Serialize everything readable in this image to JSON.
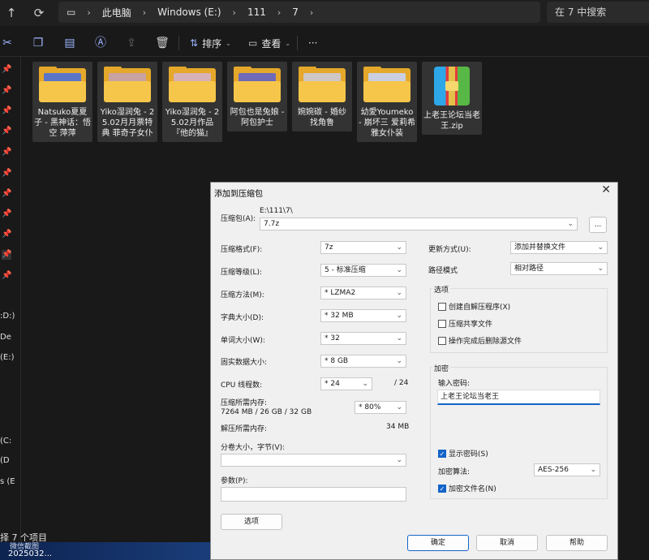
{
  "topbar": {
    "path": [
      "此电脑",
      "Windows (E:)",
      "111",
      "7"
    ],
    "search_placeholder": "在 7 中搜索"
  },
  "toolbar": {
    "sort_label": "排序",
    "view_label": "查看",
    "more_label": "···"
  },
  "sidebar": {
    "drive_labels": [
      ":D:)",
      "De",
      "(E:)",
      "(C:",
      "(D",
      "s (E"
    ]
  },
  "files": [
    {
      "name": "Natsuko夏夏子 - 黑神话：悟空 萍萍",
      "type": "folder",
      "img_color": "#5a74c8"
    },
    {
      "name": "Yiko湿润兔 - 25.02月月票特典 菲奇子女仆",
      "type": "folder",
      "img_color": "#c9a2a2"
    },
    {
      "name": "Yiko湿润兔 - 25.02月作品『他的猫』",
      "type": "folder",
      "img_color": "#d6b2b8"
    },
    {
      "name": "阿包也是兔娘 - 阿包护士",
      "type": "folder",
      "img_color": "#6e6ab8"
    },
    {
      "name": "婉婉碳 - 婚纱 找角鲁",
      "type": "folder",
      "img_color": "#cfc6c6"
    },
    {
      "name": "幼愛Youmeko - 崩坏三 爱莉希雅女仆装",
      "type": "folder",
      "img_color": "#c9cfe0"
    },
    {
      "name": "上老王论坛当老王.zip",
      "type": "zip"
    }
  ],
  "status": {
    "items": "择 7 个项目",
    "taskbar_line1": "微信截图",
    "taskbar_line2": "2025032..."
  },
  "dialog": {
    "title": "添加到压缩包",
    "archive_label": "压缩包(A):",
    "archive_path": "E:\\111\\7\\",
    "archive_name": "7.7z",
    "browse_label": "...",
    "format_label": "压缩格式(F):",
    "format_value": "7z",
    "level_label": "压缩等级(L):",
    "level_value": "5 - 标准压缩",
    "method_label": "压缩方法(M):",
    "method_value": "* LZMA2",
    "dict_label": "字典大小(D):",
    "dict_value": "* 32 MB",
    "word_label": "单词大小(W):",
    "word_value": "* 32",
    "solid_label": "固实数据大小:",
    "solid_value": "* 8 GB",
    "cpu_label": "CPU 线程数:",
    "cpu_value": "* 24",
    "cpu_total": "/ 24",
    "mem_label": "压缩所需内存:",
    "mem_detail": "7264 MB / 26 GB / 32 GB",
    "mem_value": "* 80%",
    "decomp_label": "解压所需内存:",
    "decomp_value": "34 MB",
    "split_label": "分卷大小，字节(V):",
    "split_value": "",
    "params_label": "参数(P):",
    "params_value": "",
    "options_button": "选项",
    "update_label": "更新方式(U):",
    "update_value": "添加并替换文件",
    "path_label": "路径模式",
    "path_value": "相对路径",
    "options_group": "选项",
    "opt_sfx": "创建自解压程序(X)",
    "opt_shared": "压缩共享文件",
    "opt_delete": "操作完成后删除源文件",
    "enc_group": "加密",
    "pwd_label": "输入密码:",
    "pwd_value": "上老王论坛当老王",
    "show_pwd": "显示密码(S)",
    "enc_method_label": "加密算法:",
    "enc_method_value": "AES-256",
    "enc_names": "加密文件名(N)",
    "ok": "确定",
    "cancel": "取消",
    "help": "帮助"
  }
}
